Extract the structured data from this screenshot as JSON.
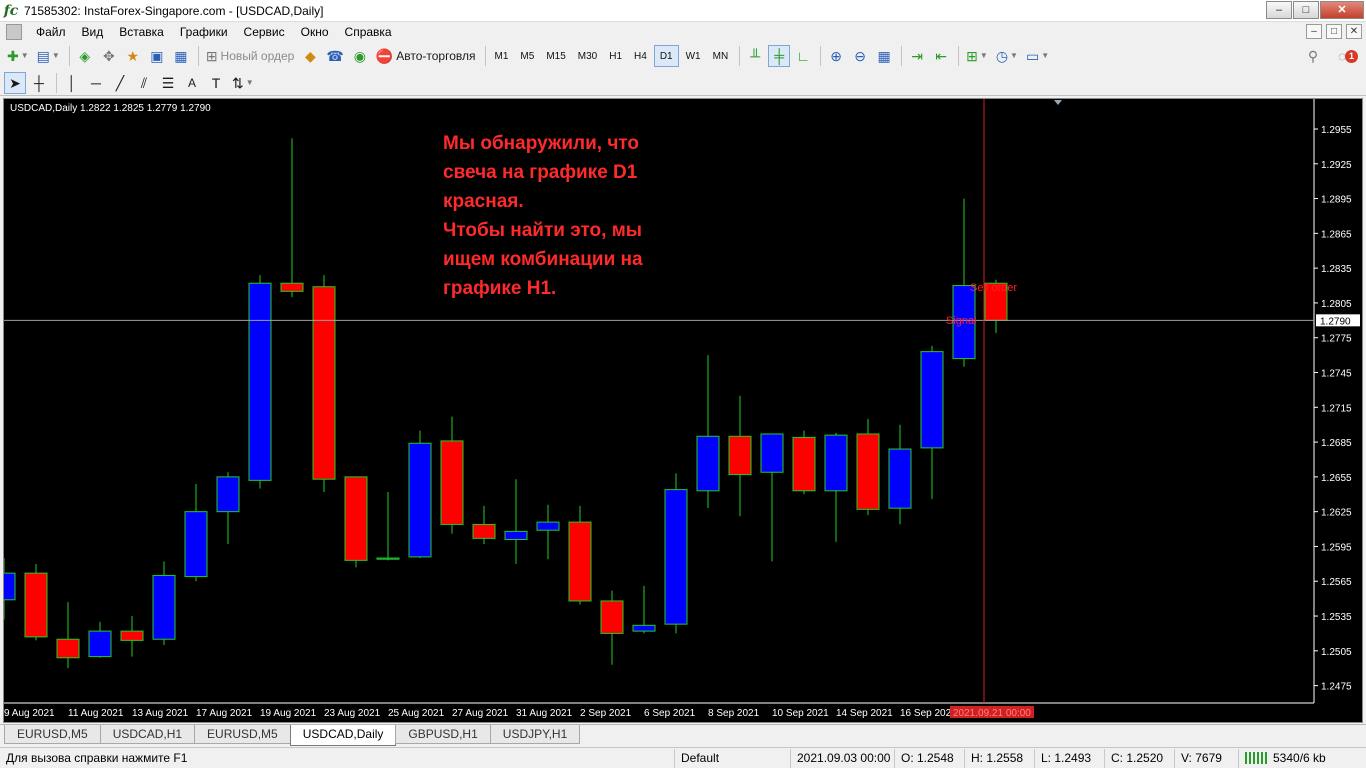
{
  "window": {
    "title": "71585302: InstaForex-Singapore.com - [USDCAD,Daily]",
    "minimize": "–",
    "maximize": "□",
    "close": "✕"
  },
  "menu": {
    "items": [
      "Файл",
      "Вид",
      "Вставка",
      "Графики",
      "Сервис",
      "Окно",
      "Справка"
    ]
  },
  "toolbar1": {
    "new_order_label": "Новый ордер",
    "autotrading_label": "Авто-торговля",
    "timeframes": [
      "M1",
      "M5",
      "M15",
      "M30",
      "H1",
      "H4",
      "D1",
      "W1",
      "MN"
    ],
    "active_timeframe": "D1",
    "notification_count": "1"
  },
  "toolbar2": {
    "text_tool": "A"
  },
  "chart": {
    "header": "USDCAD,Daily  1.2822 1.2825 1.2779 1.2790",
    "current_price_label": "1.2790",
    "cursor_time_label": "2021.09.21 00:00",
    "sell_order_label": "Sell order",
    "signal_label": "Signal",
    "annotation": [
      "Мы обнаружили, что",
      "свеча на графике D1",
      "красная.",
      "Чтобы найти это, мы",
      "ищем комбинации на",
      "графике H1."
    ],
    "colors": {
      "bull": "#0000ff",
      "bear": "#ff0000",
      "wick": "#22cc22",
      "background": "#000000",
      "text": "#ffffff"
    }
  },
  "chart_data": {
    "type": "candlestick",
    "title": "USDCAD,Daily",
    "ylim": [
      1.246,
      1.298
    ],
    "y_ticks": [
      "1.2955",
      "1.2925",
      "1.2895",
      "1.2865",
      "1.2835",
      "1.2805",
      "1.2775",
      "1.2745",
      "1.2715",
      "1.2685",
      "1.2655",
      "1.2625",
      "1.2595",
      "1.2565",
      "1.2535",
      "1.2505",
      "1.2475"
    ],
    "x_labels": [
      "9 Aug 2021",
      "11 Aug 2021",
      "13 Aug 2021",
      "17 Aug 2021",
      "19 Aug 2021",
      "23 Aug 2021",
      "25 Aug 2021",
      "27 Aug 2021",
      "31 Aug 2021",
      "2 Sep 2021",
      "6 Sep 2021",
      "8 Sep 2021",
      "10 Sep 2021",
      "14 Sep 2021",
      "16 Sep 2021"
    ],
    "current_price": 1.279,
    "candles": [
      {
        "o": 1.2549,
        "h": 1.2585,
        "l": 1.2532,
        "c": 1.2572
      },
      {
        "o": 1.2572,
        "h": 1.258,
        "l": 1.2514,
        "c": 1.2517
      },
      {
        "o": 1.2515,
        "h": 1.2547,
        "l": 1.249,
        "c": 1.2499
      },
      {
        "o": 1.25,
        "h": 1.253,
        "l": 1.2499,
        "c": 1.2522
      },
      {
        "o": 1.2522,
        "h": 1.2535,
        "l": 1.25,
        "c": 1.2514
      },
      {
        "o": 1.2515,
        "h": 1.2582,
        "l": 1.251,
        "c": 1.257
      },
      {
        "o": 1.2569,
        "h": 1.2649,
        "l": 1.2565,
        "c": 1.2625
      },
      {
        "o": 1.2625,
        "h": 1.2659,
        "l": 1.2597,
        "c": 1.2655
      },
      {
        "o": 1.2652,
        "h": 1.2829,
        "l": 1.2645,
        "c": 1.2822
      },
      {
        "o": 1.2822,
        "h": 1.2947,
        "l": 1.281,
        "c": 1.2815
      },
      {
        "o": 1.2819,
        "h": 1.2829,
        "l": 1.2642,
        "c": 1.2653
      },
      {
        "o": 1.2655,
        "h": 1.2655,
        "l": 1.2577,
        "c": 1.2583
      },
      {
        "o": 1.2584,
        "h": 1.2642,
        "l": 1.2583,
        "c": 1.2585
      },
      {
        "o": 1.2586,
        "h": 1.2695,
        "l": 1.2585,
        "c": 1.2684
      },
      {
        "o": 1.2686,
        "h": 1.2707,
        "l": 1.2606,
        "c": 1.2614
      },
      {
        "o": 1.2614,
        "h": 1.263,
        "l": 1.2597,
        "c": 1.2602
      },
      {
        "o": 1.2601,
        "h": 1.2653,
        "l": 1.258,
        "c": 1.2608
      },
      {
        "o": 1.2609,
        "h": 1.2631,
        "l": 1.2584,
        "c": 1.2616
      },
      {
        "o": 1.2616,
        "h": 1.263,
        "l": 1.2545,
        "c": 1.2548
      },
      {
        "o": 1.2548,
        "h": 1.2557,
        "l": 1.2493,
        "c": 1.252
      },
      {
        "o": 1.2522,
        "h": 1.2561,
        "l": 1.252,
        "c": 1.2527
      },
      {
        "o": 1.2528,
        "h": 1.2658,
        "l": 1.252,
        "c": 1.2644
      },
      {
        "o": 1.2643,
        "h": 1.276,
        "l": 1.2628,
        "c": 1.269
      },
      {
        "o": 1.269,
        "h": 1.2725,
        "l": 1.2621,
        "c": 1.2657
      },
      {
        "o": 1.2659,
        "h": 1.2692,
        "l": 1.2582,
        "c": 1.2692
      },
      {
        "o": 1.2689,
        "h": 1.2695,
        "l": 1.264,
        "c": 1.2643
      },
      {
        "o": 1.2643,
        "h": 1.2693,
        "l": 1.2599,
        "c": 1.2691
      },
      {
        "o": 1.2692,
        "h": 1.2705,
        "l": 1.2622,
        "c": 1.2627
      },
      {
        "o": 1.2628,
        "h": 1.27,
        "l": 1.2614,
        "c": 1.2679
      },
      {
        "o": 1.268,
        "h": 1.2768,
        "l": 1.2636,
        "c": 1.2763
      },
      {
        "o": 1.2757,
        "h": 1.2895,
        "l": 1.275,
        "c": 1.282
      },
      {
        "o": 1.2822,
        "h": 1.2825,
        "l": 1.2779,
        "c": 1.279
      }
    ]
  },
  "tabs": {
    "items": [
      "EURUSD,M5",
      "USDCAD,H1",
      "EURUSD,M5",
      "USDCAD,Daily",
      "GBPUSD,H1",
      "USDJPY,H1"
    ],
    "active_index": 3
  },
  "statusbar": {
    "help": "Для вызова справки нажмите F1",
    "profile": "Default",
    "datetime": "2021.09.03 00:00",
    "open": "O: 1.2548",
    "high": "H: 1.2558",
    "low": "L: 1.2493",
    "close": "C: 1.2520",
    "volume": "V: 7679",
    "traffic": "5340/6 kb"
  }
}
